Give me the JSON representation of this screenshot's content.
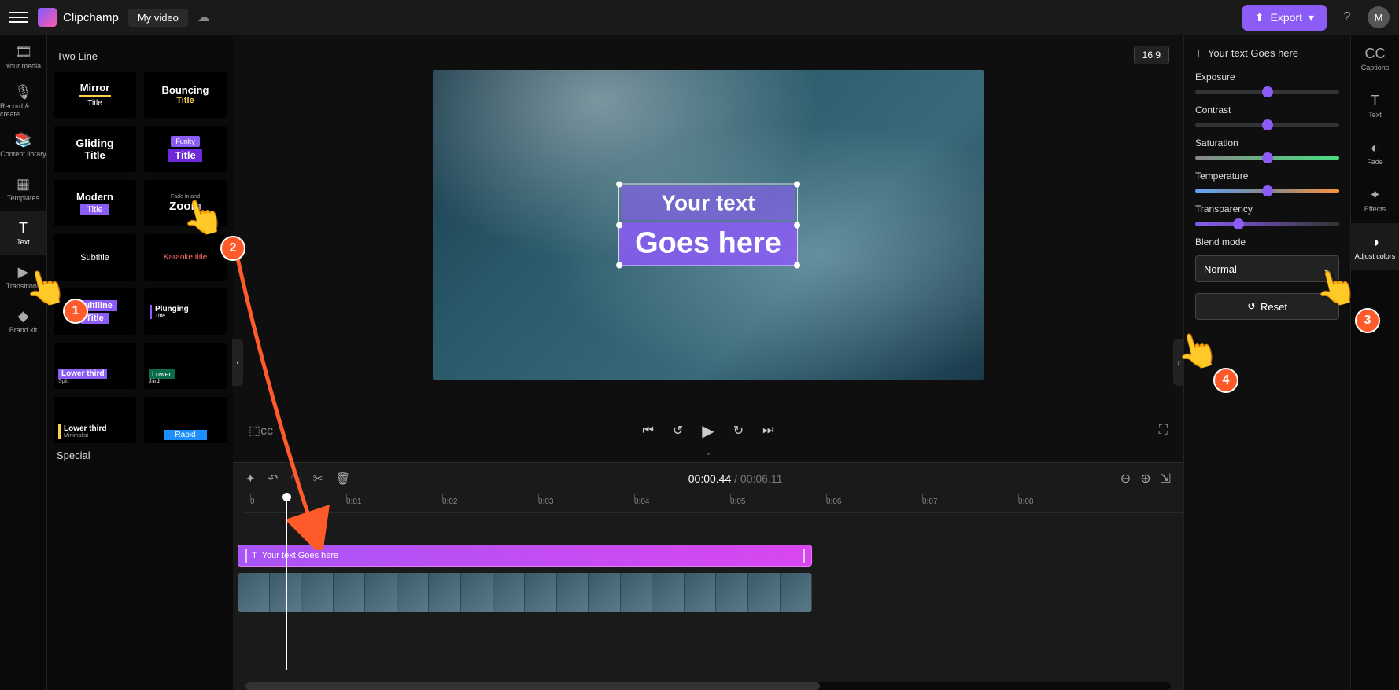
{
  "header": {
    "app_name": "Clipchamp",
    "project_name": "My video",
    "export_label": "Export",
    "avatar_initial": "M"
  },
  "left_nav": [
    {
      "label": "Your media",
      "icon": "🎞"
    },
    {
      "label": "Record & create",
      "icon": "🎙"
    },
    {
      "label": "Content library",
      "icon": "📚"
    },
    {
      "label": "Templates",
      "icon": "▦"
    },
    {
      "label": "Text",
      "icon": "T"
    },
    {
      "label": "Transitions",
      "icon": "▶"
    },
    {
      "label": "Brand kit",
      "icon": "◆"
    }
  ],
  "template_panel": {
    "section": "Two Line",
    "section2": "Special",
    "cards": [
      {
        "l1": "Mirror",
        "l2": "Title"
      },
      {
        "l1": "Bouncing",
        "l2": "Title"
      },
      {
        "l1": "Gliding",
        "l2": "Title"
      },
      {
        "l1": "Funky",
        "l2": "Title"
      },
      {
        "l1": "Modern",
        "l2": "Title"
      },
      {
        "small": "Fade in and",
        "l1": "Zoom"
      },
      {
        "l1": "Subtitle"
      },
      {
        "l1": "Karaoke title"
      },
      {
        "l1": "Multiline",
        "l2": "Title"
      },
      {
        "l1": "Plunging",
        "l2": "Title"
      },
      {
        "l1": "Lower third",
        "l2": "Split"
      },
      {
        "l1": "Lower",
        "l2": "third"
      },
      {
        "l1": "Lower third",
        "l2": "Minimalist"
      },
      {
        "l1": "Rapid"
      }
    ]
  },
  "preview": {
    "aspect": "16:9",
    "text_line1": "Your text",
    "text_line2": "Goes here"
  },
  "timecode": {
    "current": "00:00.44",
    "sep": " / ",
    "duration": "00:06.11"
  },
  "ruler": [
    "0",
    "0:01",
    "0:02",
    "0:03",
    "0:04",
    "0:05",
    "0:06",
    "0:07",
    "0:08"
  ],
  "text_clip_label": "Your text Goes here",
  "right_panel": {
    "header": "Your text Goes here",
    "sliders": [
      {
        "label": "Exposure",
        "pos": 50
      },
      {
        "label": "Contrast",
        "pos": 50
      },
      {
        "label": "Saturation",
        "pos": 50
      },
      {
        "label": "Temperature",
        "pos": 50
      },
      {
        "label": "Transparency",
        "pos": 30
      }
    ],
    "blend_label": "Blend mode",
    "blend_value": "Normal",
    "reset_label": "Reset"
  },
  "far_right_nav": [
    {
      "label": "Captions",
      "icon": "CC"
    },
    {
      "label": "Text",
      "icon": "T"
    },
    {
      "label": "Fade",
      "icon": "◐"
    },
    {
      "label": "Effects",
      "icon": "✦"
    },
    {
      "label": "Adjust colors",
      "icon": "◑"
    }
  ]
}
